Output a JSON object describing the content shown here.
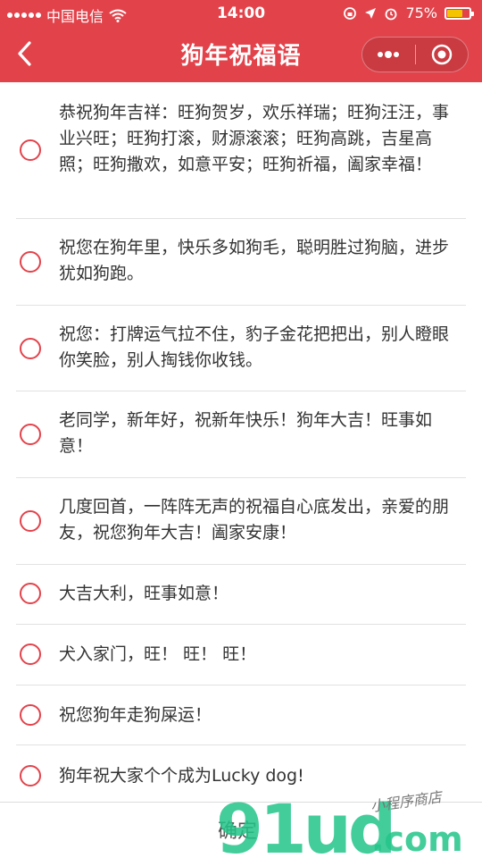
{
  "status": {
    "carrier": "中国电信",
    "time": "14:00",
    "battery": "75%",
    "battery_level": 0.75,
    "battery_color": "#f5c400"
  },
  "nav": {
    "title": "狗年祝福语",
    "accent": "#e2434b"
  },
  "items": [
    {
      "text": "恭祝狗年吉祥：旺狗贺岁，欢乐祥瑞；旺狗汪汪，事业兴旺；旺狗打滚，财源滚滚；旺狗高跳，吉星高照；旺狗撒欢，如意平安；旺狗祈福，阖家幸福！"
    },
    {
      "text": "祝您在狗年里，快乐多如狗毛，聪明胜过狗脑，进步犹如狗跑。"
    },
    {
      "text": "祝您：打牌运气拉不住，豹子金花把把出，别人瞪眼你笑脸，别人掏钱你收钱。"
    },
    {
      "text": "老同学，新年好，祝新年快乐！狗年大吉！旺事如意！"
    },
    {
      "text": "几度回首，一阵阵无声的祝福自心底发出，亲爱的朋友，祝您狗年大吉！阖家安康！"
    },
    {
      "text": "大吉大利，旺事如意！"
    },
    {
      "text": "犬入家门，旺！ 旺！ 旺！"
    },
    {
      "text": "祝您狗年走狗屎运！"
    },
    {
      "text": "狗年祝大家个个成为Lucky dog!"
    }
  ],
  "footer": {
    "confirm_label": "确定"
  },
  "watermark": {
    "big": "91ud",
    "small": "小程序商店",
    "domain": ".com"
  }
}
